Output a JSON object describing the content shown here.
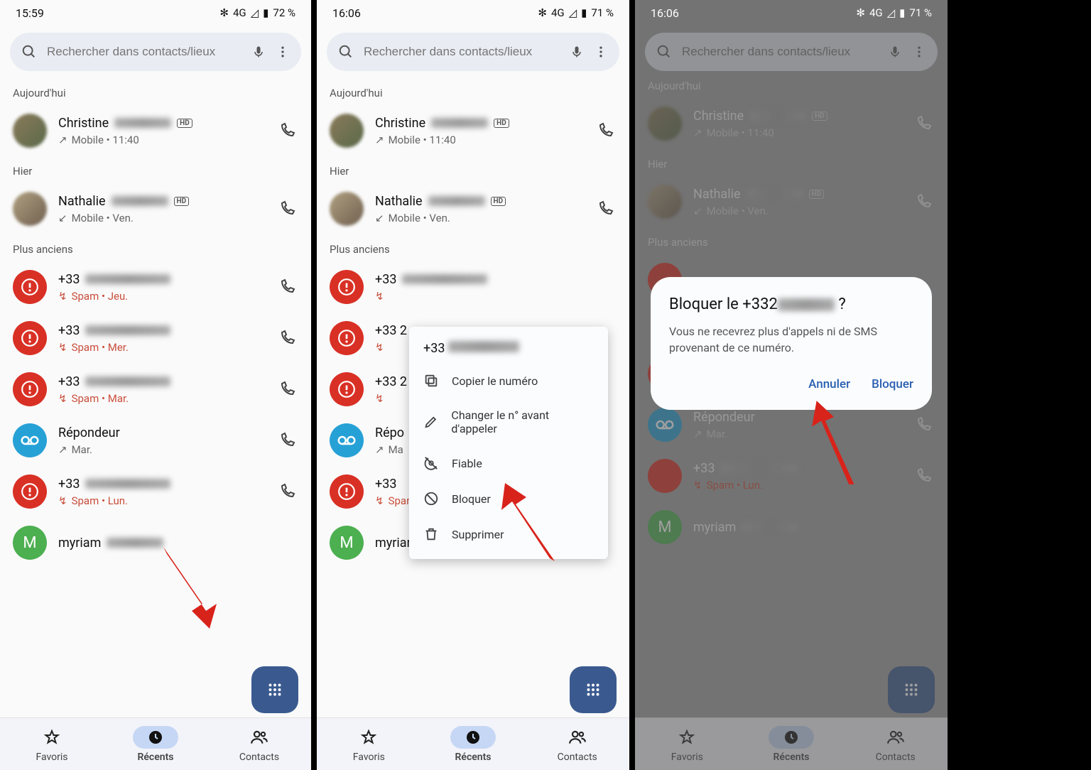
{
  "screens": [
    {
      "time": "15:59",
      "net": "4G",
      "batt": "72 %"
    },
    {
      "time": "16:06",
      "net": "4G",
      "batt": "71 %"
    },
    {
      "time": "16:06",
      "net": "4G",
      "batt": "71 %"
    }
  ],
  "search": {
    "placeholder": "Rechercher dans contacts/lieux"
  },
  "sections": {
    "today": "Aujourd'hui",
    "yesterday": "Hier",
    "older": "Plus anciens"
  },
  "calls": {
    "christine": {
      "name": "Christine",
      "sub": "Mobile • 11:40",
      "hd": true
    },
    "nathalie": {
      "name": "Nathalie",
      "sub": "Mobile • Ven.",
      "hd": true
    },
    "spam1": {
      "name": "+33",
      "sub": "Spam • Jeu."
    },
    "spam2": {
      "name": "+33",
      "sub": "Spam • Mer."
    },
    "spam2b": {
      "name": "+33 2",
      "sub": "Spam • Mer."
    },
    "spam3": {
      "name": "+33",
      "sub": "Spam • Mar."
    },
    "spam3b": {
      "name": "+33 2",
      "sub": "Spam • Mar."
    },
    "voicemail": {
      "name": "Répondeur",
      "sub": "Mar."
    },
    "spam4": {
      "name": "+33",
      "sub": "Spam • Lun."
    },
    "myriam": {
      "name": "myriam",
      "letter": "M"
    }
  },
  "nav": {
    "fav": "Favoris",
    "recent": "Récents",
    "contacts": "Contacts"
  },
  "popup": {
    "title": "+33",
    "copy": "Copier le numéro",
    "edit": "Changer le n° avant d'appeler",
    "trust": "Fiable",
    "block": "Bloquer",
    "delete": "Supprimer"
  },
  "dialog": {
    "title_pre": "Bloquer le +332",
    "title_suf": " ?",
    "body": "Vous ne recevrez plus d'appels ni de SMS provenant de ce numéro.",
    "cancel": "Annuler",
    "confirm": "Bloquer"
  }
}
